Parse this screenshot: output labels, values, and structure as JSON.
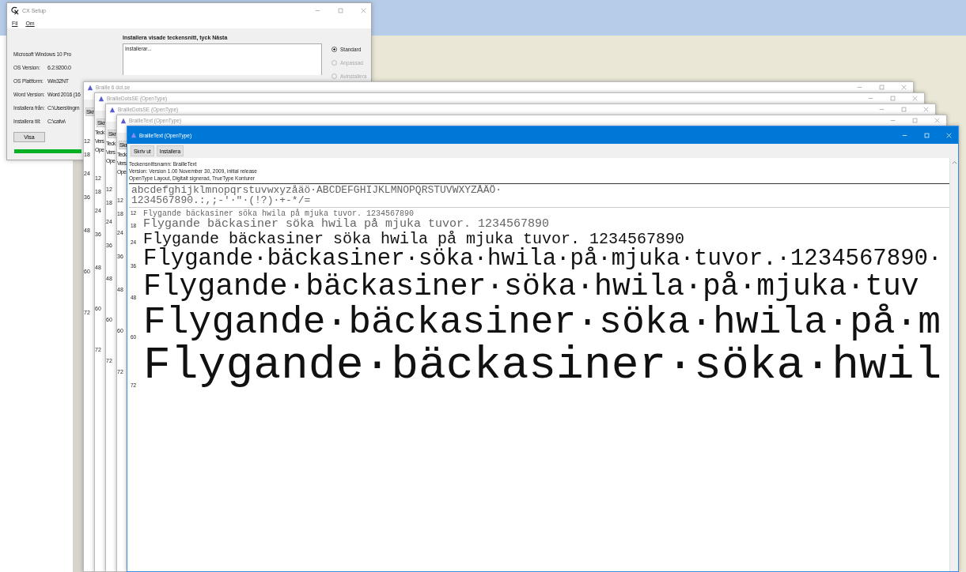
{
  "setup_window": {
    "title": "CX Setup",
    "menu": [
      "Fil",
      "Om"
    ],
    "heading": "Installera visade teckensnitt, tyck Nästa",
    "info": [
      {
        "label": "Microsoft Windows 10 Pro"
      },
      {
        "label": "OS Version:",
        "value": "6.2.9200.0"
      },
      {
        "label": "OS Plattform:",
        "value": "Win32NT"
      },
      {
        "label": "Word Version:",
        "value": "Word 2016 (16"
      },
      {
        "label": "Installera från:",
        "value": "C:\\Users\\Ingm"
      },
      {
        "label": "Installera till:",
        "value": "C:\\cafw\\"
      }
    ],
    "show_button": "Visa",
    "log": "Installerar...",
    "options": [
      {
        "label": "Standard",
        "selected": true,
        "disabled": false
      },
      {
        "label": "Anpassad",
        "selected": false,
        "disabled": true
      },
      {
        "label": "Avinstallera",
        "selected": false,
        "disabled": true
      }
    ],
    "progress": {
      "level": 1
    }
  },
  "back_windows": [
    {
      "title": "Braille 6 dot.se",
      "active": false,
      "button": "Skr",
      "sizes": [
        "12",
        "18",
        "24",
        "36",
        "48",
        "60",
        "72"
      ]
    },
    {
      "title": "BrailleDotsSE (OpenType)",
      "active": false,
      "button": "Skr",
      "info": [
        "Teck",
        "Vers",
        "Ope"
      ],
      "sizes": [
        "12",
        "18",
        "24",
        "36",
        "48",
        "60",
        "72"
      ]
    },
    {
      "title": "BrailleDotsSE (OpenType)",
      "active": false,
      "button": "Skr",
      "info": [
        "Teck",
        "Vers",
        "Ope"
      ],
      "sizes": [
        "12",
        "18",
        "24",
        "36",
        "48",
        "60",
        "72"
      ]
    },
    {
      "title": "BrailleText (OpenType)",
      "active": false,
      "button": "Skr",
      "info": [
        "Teck",
        "Vers",
        "Ope"
      ],
      "sizes": [
        "12",
        "18",
        "24",
        "36",
        "48",
        "60",
        "72"
      ]
    }
  ],
  "front_window": {
    "title": "BrailleText (OpenType)",
    "active": true,
    "buttons": [
      "Skriv ut",
      "Installera"
    ],
    "info": [
      "Teckensnittsnamn: BrailleText",
      "Version: Version 1.00 November 30, 2009, initial release",
      "OpenType Layout, Digitalt signerad, TrueType Konturer"
    ],
    "charset": [
      "abcdefghijklmnopqrstuvwxyzåäö·ABCDEFGHIJKLMNOPQRSTUVWXYZÅÄÖ·",
      "1234567890.:,;-'·\"·(!?)·+-*/="
    ],
    "samples": [
      {
        "size": "12",
        "text": "Flygande bäckasiner söka hwila på mjuka tuvor. 1234567890"
      },
      {
        "size": "18",
        "text": "Flygande bäckasiner söka hwila på mjuka tuvor. 1234567890"
      },
      {
        "size": "24",
        "text": "Flygande bäckasiner söka hwila på mjuka tuvor. 1234567890"
      },
      {
        "size": "36",
        "text": "Flygande·bäckasiner·söka·hwila·på·mjuka·tuvor.·1234567890·"
      },
      {
        "size": "48",
        "text": "Flygande·bäckasiner·söka·hwila·på·mjuka·tuv"
      },
      {
        "size": "60",
        "text": "Flygande·bäckasiner·söka·hwila·på·m"
      },
      {
        "size": "72",
        "text": "Flygande·bäckasiner·söka·hwil"
      }
    ]
  }
}
